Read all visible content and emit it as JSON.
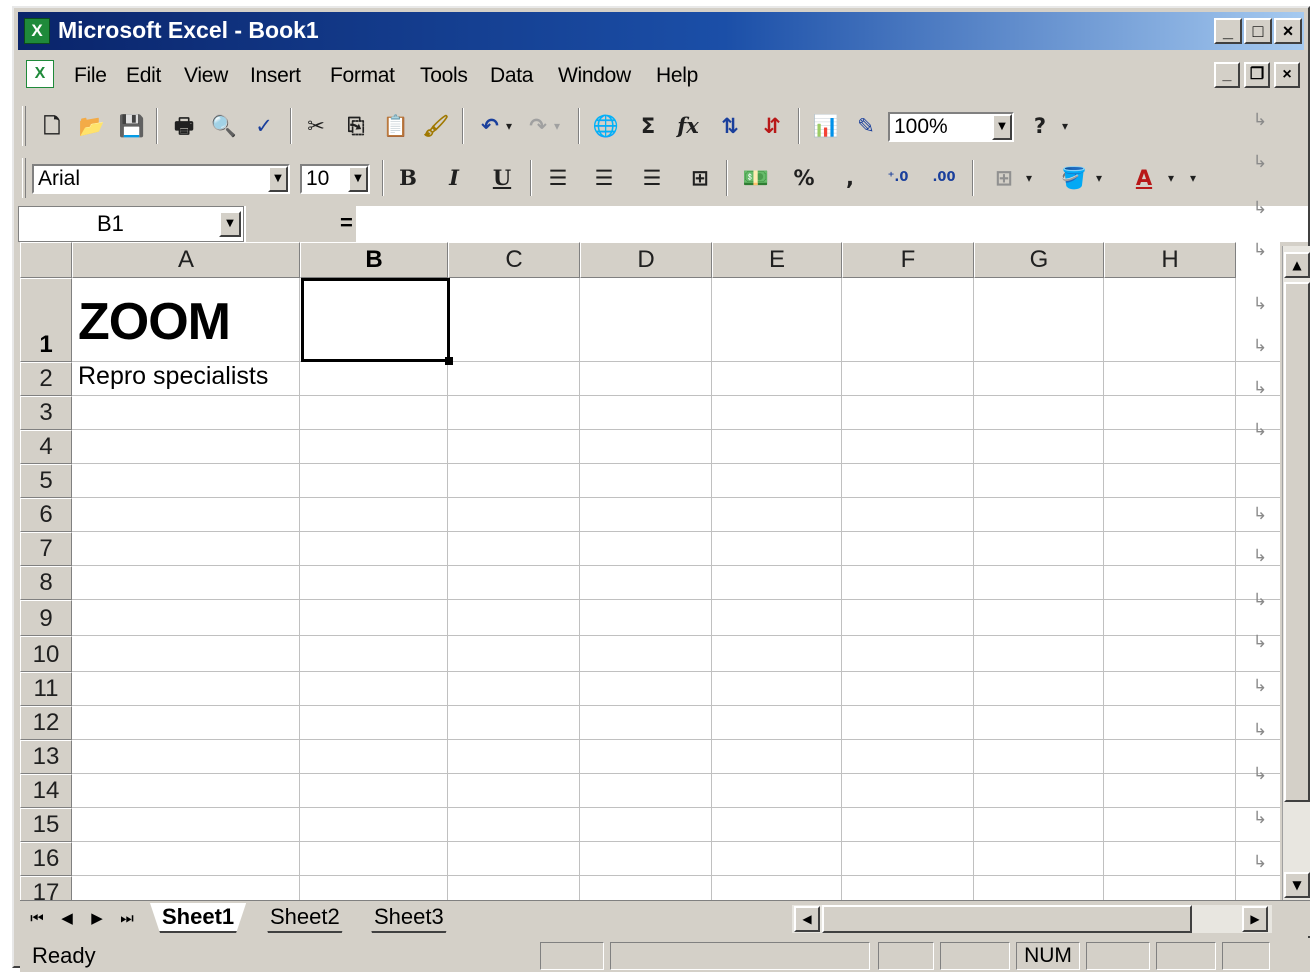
{
  "window": {
    "title": "Microsoft Excel - Book1",
    "app_icon": "excel-icon"
  },
  "menu": {
    "items": [
      "File",
      "Edit",
      "View",
      "Insert",
      "Format",
      "Tools",
      "Data",
      "Window",
      "Help"
    ]
  },
  "toolbar": {
    "zoom": "100%",
    "font": "Arial",
    "font_size": "10",
    "bold_label": "B",
    "italic_label": "I",
    "underline_label": "U",
    "percent_label": "%",
    "comma_label": ",",
    "sum_label": "Σ",
    "fx_label": "fx",
    "help_label": "?"
  },
  "formula_bar": {
    "name_box": "B1",
    "equals": "=",
    "formula": ""
  },
  "grid": {
    "columns": [
      "A",
      "B",
      "C",
      "D",
      "E",
      "F",
      "G",
      "H"
    ],
    "rows": [
      "1",
      "2",
      "3",
      "4",
      "5",
      "6",
      "7",
      "8",
      "9",
      "10",
      "11",
      "12",
      "13",
      "14",
      "15",
      "16",
      "17"
    ],
    "active_column": "B",
    "active_row": "1",
    "cells": {
      "A1": "ZOOM",
      "A2": "Repro specialists"
    }
  },
  "sheets": {
    "tabs": [
      "Sheet1",
      "Sheet2",
      "Sheet3"
    ],
    "active": "Sheet1"
  },
  "status": {
    "text": "Ready",
    "num": "NUM"
  },
  "colors": {
    "title_gradient_start": "#0a246a",
    "title_gradient_end": "#a6caf0",
    "chrome": "#d4d0c8",
    "excel_green": "#1f8a3a"
  }
}
